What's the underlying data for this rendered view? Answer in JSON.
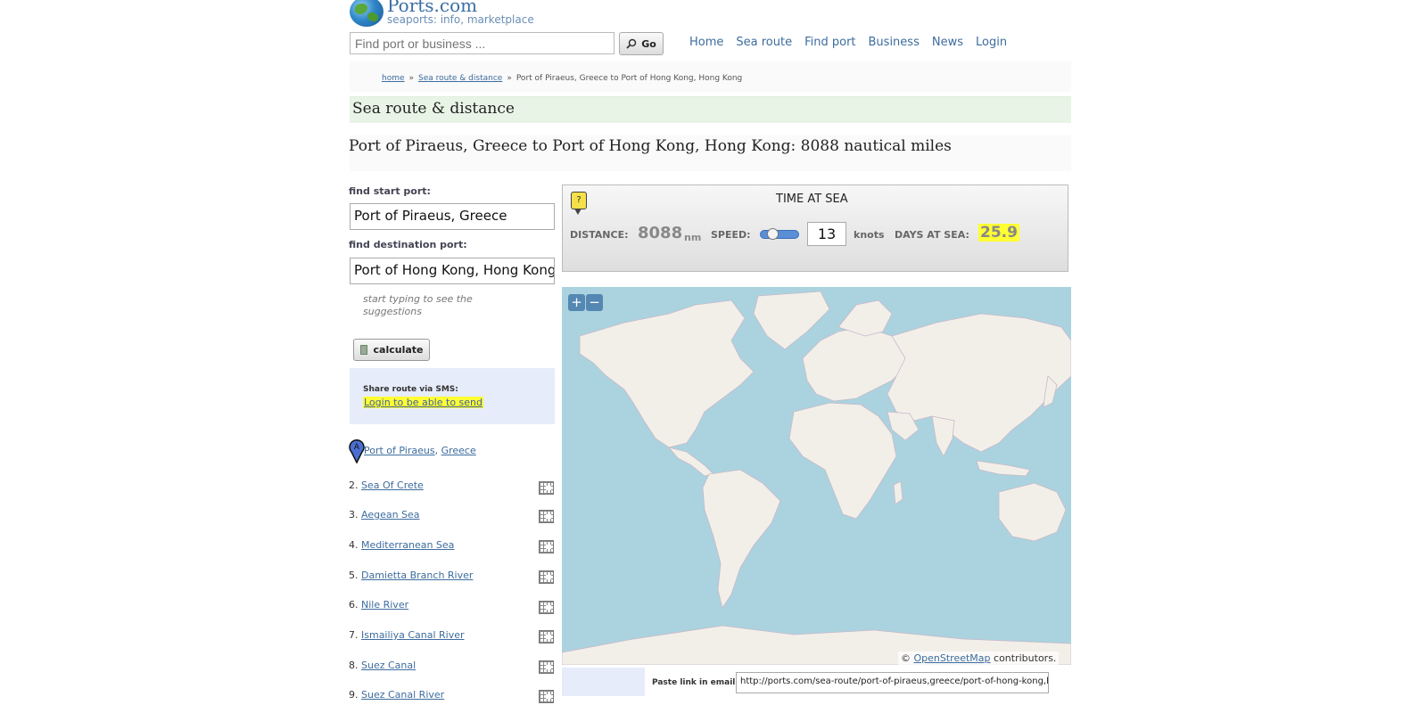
{
  "header": {
    "logo_title": "Ports.com",
    "logo_subtitle": "seaports: info, marketplace",
    "search_placeholder": "Find port or business ...",
    "go_label": "Go",
    "nav": [
      "Home",
      "Sea route",
      "Find port",
      "Business",
      "News",
      "Login"
    ]
  },
  "breadcrumb": {
    "home": "home",
    "sep": "»",
    "section": "Sea route & distance",
    "current": "Port of Piraeus, Greece to Port of Hong Kong, Hong Kong"
  },
  "section_title": "Sea route & distance",
  "route_title": "Port of Piraeus, Greece to Port of Hong Kong, Hong Kong: 8088 nautical miles",
  "form": {
    "start_label": "find start port:",
    "start_value": "Port of Piraeus, Greece",
    "dest_label": "find destination port:",
    "dest_value": "Port of Hong Kong, Hong Kong",
    "hint": "start typing to see the suggestions",
    "calculate_label": "calculate"
  },
  "sms": {
    "title": "Share route via SMS:",
    "link": "Login to be able to send"
  },
  "start_point": {
    "marker": "A",
    "port": "Port of Piraeus",
    "comma": ",",
    "country": "Greece"
  },
  "waypoints": [
    {
      "num": "2.",
      "name": "Sea Of Crete"
    },
    {
      "num": "3.",
      "name": "Aegean Sea"
    },
    {
      "num": "4.",
      "name": "Mediterranean Sea"
    },
    {
      "num": "5.",
      "name": "Damietta Branch River"
    },
    {
      "num": "6.",
      "name": "Nile River"
    },
    {
      "num": "7.",
      "name": "Ismailiya Canal River"
    },
    {
      "num": "8.",
      "name": "Suez Canal"
    },
    {
      "num": "9.",
      "name": "Suez Canal River"
    }
  ],
  "time_at_sea": {
    "help": "?",
    "title": "TIME AT SEA",
    "distance_label": "DISTANCE:",
    "distance_value": "8088",
    "distance_unit": "nm",
    "speed_label": "SPEED:",
    "speed_value": "13",
    "speed_unit": "knots",
    "days_label": "DAYS AT SEA:",
    "days_value": "25.9"
  },
  "map": {
    "zoom_in": "+",
    "zoom_out": "−",
    "attribution_prefix": "©",
    "attribution_link": "OpenStreetMap",
    "attribution_suffix": "contributors."
  },
  "email": {
    "label": "Paste link in email:",
    "value": "http://ports.com/sea-route/port-of-piraeus,greece/port-of-hong-kong,hong-kong/"
  },
  "colors": {
    "sea": "#aad3df",
    "land": "#f2efe9",
    "link": "#3d6c9e",
    "highlight": "#ffff33"
  }
}
